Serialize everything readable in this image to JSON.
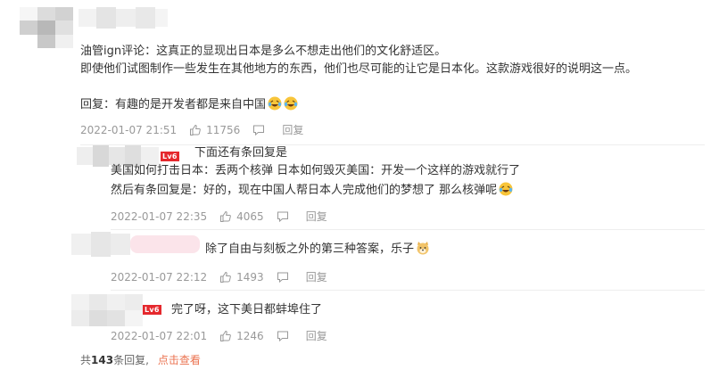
{
  "main_comment": {
    "line1": "油管ign评论：这真正的显现出日本是多么不想走出他们的文化舒适区。",
    "line2": "即使他们试图制作一些发生在其他地方的东西，他们也尽可能的让它是日本化。这款游戏很好的说明这一点。",
    "reply_text": "回复：有趣的是开发者都是来自中国",
    "time": "2022-01-07 21:51",
    "likes": "11756",
    "reply_label": "回复"
  },
  "replies": [
    {
      "badge": "Lv6",
      "lines": [
        "下面还有条回复是",
        "美国如何打击日本：丢两个核弹 日本如何毁灭美国：开发一个这样的游戏就行了",
        "然后有条回复是：好的，现在中国人帮日本人完成他们的梦想了 那么核弹呢"
      ],
      "time": "2022-01-07 22:35",
      "likes": "4065",
      "reply_label": "回复"
    },
    {
      "text": "除了自由与刻板之外的第三种答案，乐子",
      "time": "2022-01-07 22:12",
      "likes": "1493",
      "reply_label": "回复"
    },
    {
      "badge": "Lv6",
      "text": "完了呀，这下美日都蚌埠住了",
      "time": "2022-01-07 22:01",
      "likes": "1246",
      "reply_label": "回复"
    }
  ],
  "footer": {
    "prefix": "共",
    "count": "143",
    "suffix": "条回复,",
    "link": "点击查看"
  },
  "colors": {
    "link": "#eb7350",
    "badge": "#e5282d",
    "meta": "#999999"
  }
}
